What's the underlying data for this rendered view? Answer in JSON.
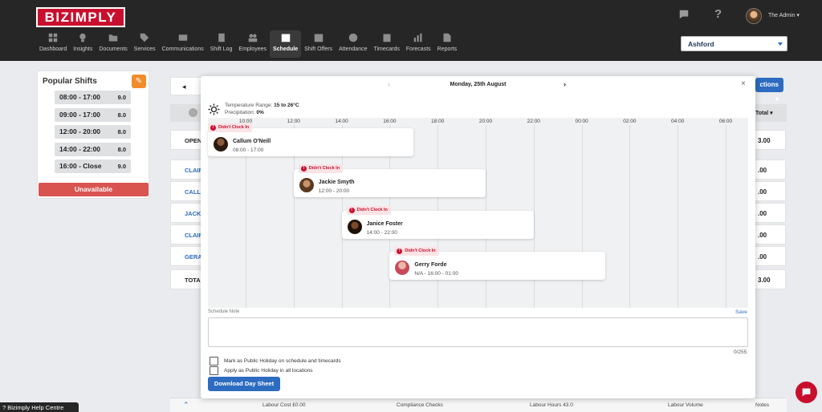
{
  "brand": "BIZIMPLY",
  "nav": [
    {
      "label": "Dashboard",
      "icon": "dashboard-icon"
    },
    {
      "label": "Insights",
      "icon": "lightbulb-icon"
    },
    {
      "label": "Documents",
      "icon": "folder-icon"
    },
    {
      "label": "Services",
      "icon": "tag-icon"
    },
    {
      "label": "Communications",
      "icon": "envelope-icon"
    },
    {
      "label": "Shift Log",
      "icon": "book-icon"
    },
    {
      "label": "Employees",
      "icon": "users-icon"
    },
    {
      "label": "Schedule",
      "icon": "calendar-icon",
      "active": true
    },
    {
      "label": "Shift Offers",
      "icon": "calendar-check-icon"
    },
    {
      "label": "Attendance",
      "icon": "clock-icon"
    },
    {
      "label": "Timecards",
      "icon": "clipboard-icon"
    },
    {
      "label": "Forecasts",
      "icon": "bar-chart-icon"
    },
    {
      "label": "Reports",
      "icon": "report-icon"
    }
  ],
  "user": {
    "name": "The Admin ▾"
  },
  "location": "Ashford",
  "popular_shifts": {
    "title": "Popular Shifts",
    "items": [
      {
        "time": "08:00 - 17:00",
        "hours": "9.0"
      },
      {
        "time": "09:00 - 17:00",
        "hours": "8.0"
      },
      {
        "time": "12:00 - 20:00",
        "hours": "8.0"
      },
      {
        "time": "14:00 - 22:00",
        "hours": "8.0"
      },
      {
        "time": "16:00 - Close",
        "hours": "9.0"
      }
    ],
    "unavailable_label": "Unavailable"
  },
  "background": {
    "actions_label": "ctions ▾",
    "total_header": "Total ▾",
    "rows": [
      {
        "left": "OPEN",
        "right": "3.00"
      },
      {
        "left": "CLAIR",
        "right": ".00"
      },
      {
        "left": "CALLU",
        "right": ".00"
      },
      {
        "left": "JACKI",
        "right": ".00"
      },
      {
        "left": "CLAIR",
        "right": ".00"
      },
      {
        "left": "GERAI",
        "right": ".00"
      },
      {
        "left": "TOTA",
        "right": "3.00"
      }
    ]
  },
  "bottom_bar": {
    "labour_cost": "Labour Cost £0.00",
    "compliance": "Compliance Checks",
    "labour_hours": "Labour Hours 43.0",
    "labour_volume": "Labour Volume",
    "notes": "Notes"
  },
  "help_label": "Bizimply Help Centre",
  "modal": {
    "date": "Monday, 25th August",
    "temperature_label": "Temperature Range:",
    "temperature_value": "15 to 26°C",
    "precipitation_label": "Precipitation:",
    "precipitation_value": "0%",
    "time_labels": [
      "10:00",
      "12:00",
      "14:00",
      "16:00",
      "18:00",
      "20:00",
      "22:00",
      "00:00",
      "02:00",
      "04:00",
      "06:00"
    ],
    "shifts": [
      {
        "name": "Callum O'Neill",
        "time": "08:00 - 17:00",
        "badge": "Didn't Clock In"
      },
      {
        "name": "Jackie Smyth",
        "time": "12:00 - 20:00",
        "badge": "Didn't Clock In"
      },
      {
        "name": "Janice Foster",
        "time": "14:00 - 22:00",
        "badge": "Didn't Clock In"
      },
      {
        "name": "Gerry Forde",
        "time": "N/A  -  16:00 - 01:00",
        "badge": "Didn't Clock In"
      }
    ],
    "schedule_note_label": "Schedule Note",
    "save_label": "Save",
    "char_count": "0/255",
    "checkbox_public_holiday": "Mark as Public Holiday on schedule and timecards",
    "checkbox_all_locations": "Apply as Public Holiday in all locations",
    "download_label": "Download Day Sheet"
  }
}
